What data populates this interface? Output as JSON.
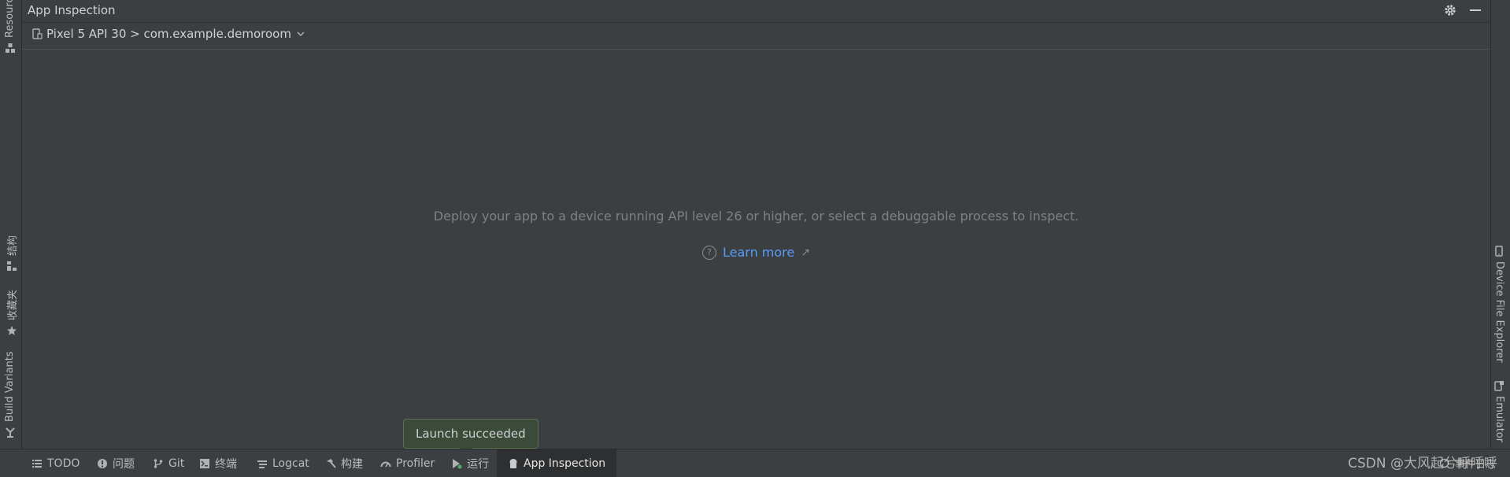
{
  "window": {
    "title": "App Inspection"
  },
  "selector": {
    "label": "Pixel 5 API 30 > com.example.demoroom"
  },
  "main": {
    "message": "Deploy your app to a device running API level 26 or higher, or select a debuggable process to inspect.",
    "learn_more": "Learn more",
    "learn_more_arrow": "↗",
    "help_glyph": "?"
  },
  "left_tabs": [
    {
      "label": "Resource",
      "icon": "resource-manager-icon"
    },
    {
      "label": "结构",
      "icon": "structure-icon"
    },
    {
      "label": "收藏夹",
      "icon": "star-icon"
    },
    {
      "label": "Build Variants",
      "icon": "build-variants-icon"
    }
  ],
  "right_tabs": [
    {
      "label": "Device File Explorer",
      "icon": "device-icon"
    },
    {
      "label": "Emulator",
      "icon": "emulator-icon"
    }
  ],
  "bottom_tabs": [
    {
      "label": "TODO",
      "icon": "list-icon"
    },
    {
      "label": "问题",
      "icon": "problems-icon"
    },
    {
      "label": "Git",
      "icon": "git-branch-icon"
    },
    {
      "label": "终端",
      "icon": "terminal-icon"
    },
    {
      "label": "Logcat",
      "icon": "logcat-icon"
    },
    {
      "label": "构建",
      "icon": "hammer-icon"
    },
    {
      "label": "Profiler",
      "icon": "profiler-icon"
    },
    {
      "label": "运行",
      "icon": "run-icon"
    },
    {
      "label": "App Inspection",
      "icon": "app-inspection-icon",
      "active": true
    }
  ],
  "status": {
    "event_log": "事件日志"
  },
  "toast": {
    "text": "Launch succeeded"
  },
  "watermark": "CSDN @大风起兮呼呼呼",
  "colors": {
    "background": "#3c3f41",
    "link": "#589df6",
    "toast_bg": "#3b4a39",
    "run_indicator": "#59a869"
  }
}
